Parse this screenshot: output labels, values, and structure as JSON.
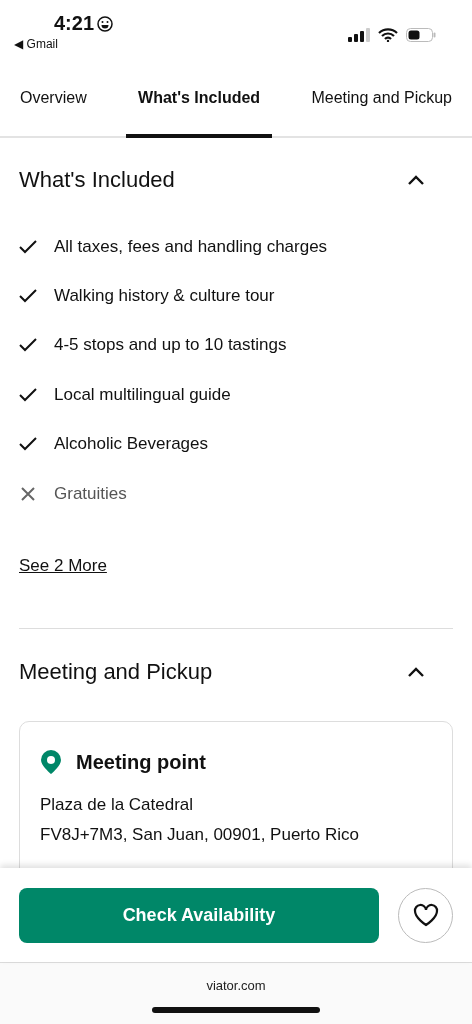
{
  "status_bar": {
    "time": "4:21",
    "back_app": "◀ Gmail"
  },
  "tabs": [
    {
      "label": "Overview",
      "selected": false
    },
    {
      "label": "What's Included",
      "selected": true
    },
    {
      "label": "Meeting and Pickup",
      "selected": false
    }
  ],
  "included_section": {
    "title": "What's Included",
    "expanded": true,
    "items": [
      {
        "text": "All taxes, fees and handling charges",
        "included": true
      },
      {
        "text": "Walking history & culture tour",
        "included": true
      },
      {
        "text": "4-5 stops and up to 10 tastings",
        "included": true
      },
      {
        "text": "Local multilingual guide",
        "included": true
      },
      {
        "text": "Alcoholic Beverages",
        "included": true
      },
      {
        "text": "Gratuities",
        "included": false
      }
    ],
    "more_link": "See 2 More"
  },
  "meeting_section": {
    "title": "Meeting and Pickup",
    "expanded": true,
    "card": {
      "title": "Meeting point",
      "lines": [
        "Plaza de la Catedral",
        "FV8J+7M3, San Juan, 00901, Puerto Rico"
      ]
    }
  },
  "bottom_bar": {
    "button": "Check Availability",
    "favorite": false
  },
  "browser_bar": {
    "url": "viator.com"
  }
}
